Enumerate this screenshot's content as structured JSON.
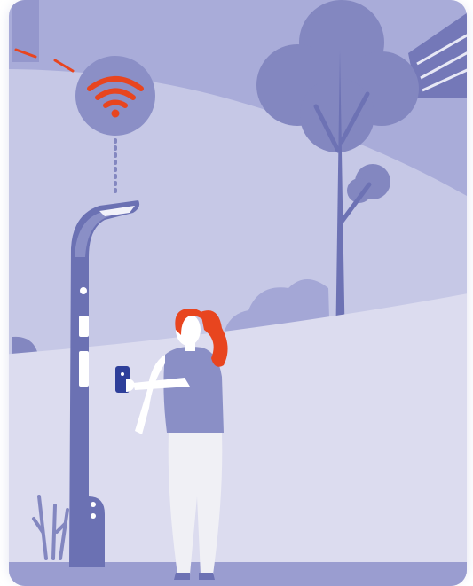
{
  "colors": {
    "sky": "#a9acd9",
    "hill": "#c6c8e6",
    "ground": "#dcdcef",
    "tree": "#8387c0",
    "tree_dark": "#6d72b4",
    "pole": "#6b71b3",
    "pole_light": "#8a8fc6",
    "wifi_circle": "#8b8fc6",
    "wifi_signal": "#e8451f",
    "hair": "#e8451f",
    "shirt": "#8a8fc6",
    "pants": "#f0f0f5",
    "skin": "#ffffff",
    "phone": "#2e3f9a"
  },
  "icons": {
    "wifi": "wifi-icon",
    "phone": "smartphone-icon"
  }
}
